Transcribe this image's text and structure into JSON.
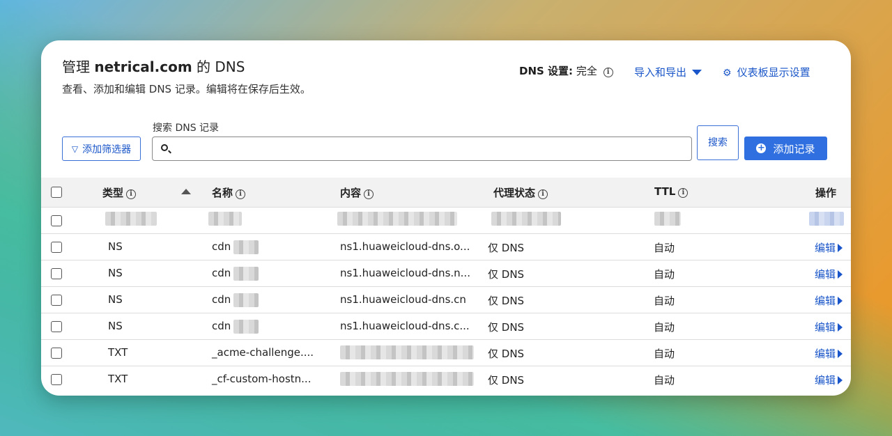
{
  "header": {
    "title_prefix": "管理",
    "domain": "netrical.com",
    "title_suffix": "的 DNS",
    "subtitle": "查看、添加和编辑 DNS 记录。编辑将在保存后生效。"
  },
  "dns_setting": {
    "label": "DNS 设置:",
    "value": "完全"
  },
  "actions": {
    "import_export": "导入和导出",
    "dashboard_settings": "仪表板显示设置",
    "add_filter": "添加筛选器",
    "search_label": "搜索 DNS 记录",
    "search_value": "",
    "search_button": "搜索",
    "add_record": "添加记录"
  },
  "columns": {
    "type": "类型",
    "name": "名称",
    "content": "内容",
    "proxy": "代理状态",
    "ttl": "TTL",
    "actions": "操作"
  },
  "rows": [
    {
      "type": "",
      "name": "",
      "content": "",
      "proxy": "",
      "ttl": "",
      "edit": "",
      "redacted": true
    },
    {
      "type": "NS",
      "name": "cdn",
      "content": "ns1.huaweicloud-dns.o...",
      "proxy": "仅 DNS",
      "ttl": "自动",
      "edit": "编辑"
    },
    {
      "type": "NS",
      "name": "cdn",
      "content": "ns1.huaweicloud-dns.n...",
      "proxy": "仅 DNS",
      "ttl": "自动",
      "edit": "编辑"
    },
    {
      "type": "NS",
      "name": "cdn",
      "content": "ns1.huaweicloud-dns.cn",
      "proxy": "仅 DNS",
      "ttl": "自动",
      "edit": "编辑"
    },
    {
      "type": "NS",
      "name": "cdn",
      "content": "ns1.huaweicloud-dns.c...",
      "proxy": "仅 DNS",
      "ttl": "自动",
      "edit": "编辑"
    },
    {
      "type": "TXT",
      "name": "_acme-challenge....",
      "content": "",
      "proxy": "仅 DNS",
      "ttl": "自动",
      "edit": "编辑"
    },
    {
      "type": "TXT",
      "name": "_cf-custom-hostn...",
      "content": "",
      "proxy": "仅 DNS",
      "ttl": "自动",
      "edit": "编辑"
    }
  ],
  "colors": {
    "accent": "#2f6fe0",
    "link": "#1a56c9",
    "header_bg": "#f2f2f2"
  },
  "icons": [
    "info-icon",
    "caret-down-icon",
    "gear-icon",
    "filter-icon",
    "search-icon",
    "plus-circle-icon",
    "sort-up-icon",
    "arrow-right-icon"
  ]
}
